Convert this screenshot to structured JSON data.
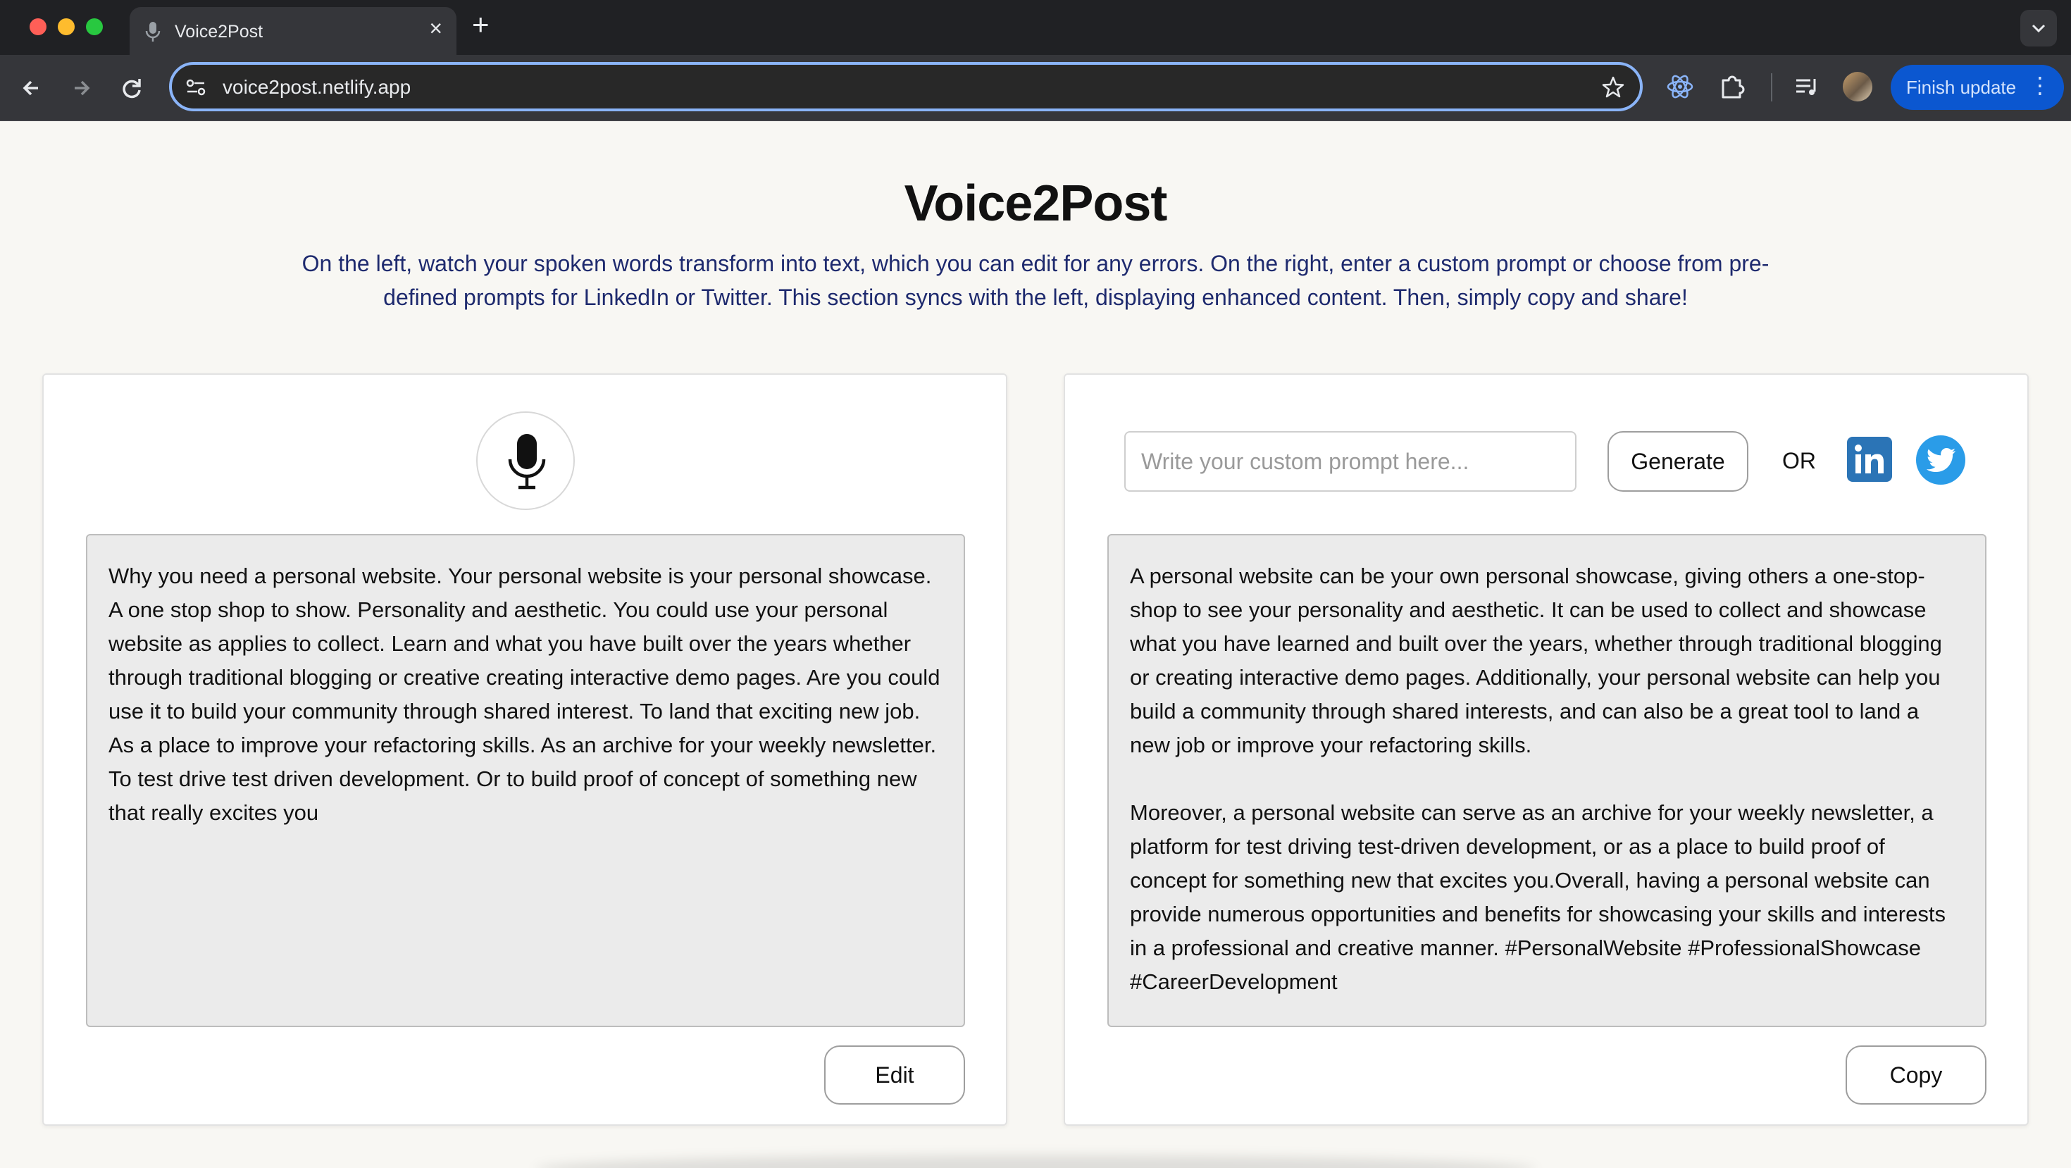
{
  "browser": {
    "tab_title": "Voice2Post",
    "url": "voice2post.netlify.app",
    "finish_update_label": "Finish update",
    "accent_color": "#0b57d0"
  },
  "header": {
    "title": "Voice2Post",
    "description": "On the left, watch your spoken words transform into text, which you can edit for any errors. On the right, enter a custom prompt or choose from pre-defined prompts for LinkedIn or Twitter. This section syncs with the left, displaying enhanced content. Then, simply copy and share!"
  },
  "left_panel": {
    "mic_icon": "microphone-icon",
    "transcript": "Why you need a personal website. Your personal website is your personal showcase. A one stop shop to show. Personality and aesthetic. You could use your personal website as applies to collect. Learn and what you have built over the years whether through traditional blogging or creative creating interactive demo pages. Are you could use it to build your community through shared interest. To land that exciting new job. As a place to improve your refactoring skills. As an archive for your weekly newsletter. To test drive test driven development. Or to build proof of concept of something new that really excites you",
    "edit_label": "Edit"
  },
  "right_panel": {
    "prompt_placeholder": "Write your custom prompt here...",
    "generate_label": "Generate",
    "or_label": "OR",
    "linkedin_icon": "linkedin-icon",
    "twitter_icon": "twitter-icon",
    "generated_text": "A personal website can be your own personal showcase, giving others a one-stop-shop to see your personality and aesthetic. It can be used to collect and showcase what you have learned and built over the years, whether through traditional blogging or creating interactive demo pages. Additionally, your personal website can help you build a community through shared interests, and can also be a great tool to land a new job or improve your refactoring skills.\n\nMoreover, a personal website can serve as an archive for your weekly newsletter, a platform for test driving test-driven development, or as a place to build proof of concept for something new that excites you.Overall, having a personal website can provide numerous opportunities and benefits for showcasing your skills and interests in a professional and creative manner. #PersonalWebsite #ProfessionalShowcase #CareerDevelopment",
    "copy_label": "Copy"
  }
}
